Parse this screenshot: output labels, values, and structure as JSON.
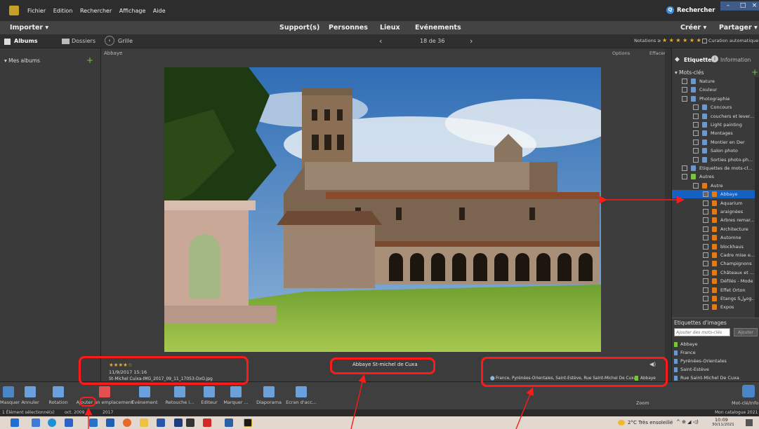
{
  "menubar": {
    "items": [
      "Fichier",
      "Edition",
      "Rechercher",
      "Affichage",
      "Aide"
    ],
    "search": "Rechercher"
  },
  "topbar": {
    "import": "Importer",
    "support": "Support(s)",
    "persons": "Personnes",
    "places": "Lieux",
    "events": "Evénements",
    "create": "Créer",
    "share": "Partager"
  },
  "subbar": {
    "albums": "Albums",
    "folders": "Dossiers",
    "grid": "Grille",
    "page": "18 de 36",
    "ratings": "Notations ≥",
    "auto_curation": "Curation automatique",
    "options": "Options",
    "clear": "Effacer"
  },
  "left": {
    "my_albums": "Mes albums"
  },
  "photo": {
    "album": "Abbaye",
    "rating": 4,
    "date": "11/9/2017 15:16",
    "filename": "St-Michel Cuixa-IMG_2017_09_11_17053-DxO.jpg",
    "caption": "Abbaye St-michel de Cuxa",
    "location": "France, Pyrénées-Orientales, Saint-Estève, Rue Saint-Michel De Cuxa",
    "tag": "Abbaye"
  },
  "right": {
    "tab_tags": "Etiquettes",
    "tab_info": "Information",
    "keywords_title": "Mots-clés",
    "keywords": [
      {
        "label": "Nature",
        "depth": 1
      },
      {
        "label": "Couleur",
        "depth": 1
      },
      {
        "label": "Photographie",
        "depth": 1
      },
      {
        "label": "Concours",
        "depth": 2
      },
      {
        "label": "couchers et lever...",
        "depth": 2
      },
      {
        "label": "Light painting",
        "depth": 2
      },
      {
        "label": "Montages",
        "depth": 2
      },
      {
        "label": "Montier en Der",
        "depth": 2
      },
      {
        "label": "Salon photo",
        "depth": 2
      },
      {
        "label": "Sorties photo-ph...",
        "depth": 2
      },
      {
        "label": "Etiquettes de mots-cl...",
        "depth": 1
      },
      {
        "label": "Autres",
        "depth": 1
      },
      {
        "label": "Autre",
        "depth": 2
      },
      {
        "label": "Abbaye",
        "depth": 3,
        "selected": true
      },
      {
        "label": "Aquarium",
        "depth": 3
      },
      {
        "label": "araignées",
        "depth": 3
      },
      {
        "label": "Arbres remar...",
        "depth": 3
      },
      {
        "label": "Architecture",
        "depth": 3
      },
      {
        "label": "Automne",
        "depth": 3
      },
      {
        "label": "blockhaus",
        "depth": 3
      },
      {
        "label": "Cadre mise e...",
        "depth": 3
      },
      {
        "label": "Champignons",
        "depth": 3
      },
      {
        "label": "Châteaux et ...",
        "depth": 3
      },
      {
        "label": "Défilés - Mode",
        "depth": 3
      },
      {
        "label": "Effet Orton",
        "depth": 3
      },
      {
        "label": "Etangs Sولog...",
        "depth": 3
      },
      {
        "label": "Expos",
        "depth": 3
      }
    ],
    "image_tags_title": "Etiquettes d'images",
    "image_tags_placeholder": "Ajouter des mots-clés",
    "add_button": "Ajouter",
    "image_tags": [
      "Abbaye",
      "France",
      "Pyrénées-Orientales",
      "Saint-Estève",
      "Rue Saint-Michel De Cuxa"
    ]
  },
  "toolbar": {
    "items": [
      "Masquer",
      "Annuler",
      "Rotation",
      "Ajouter un emplacement",
      "Evénement",
      "Retouche i...",
      "Editeur",
      "Marquer ...",
      "Diaporama",
      "Ecran d'acc..."
    ],
    "zoom": "Zoom",
    "keyword_info": "Mot-clé/Info"
  },
  "status": {
    "selected": "1 Élément sélectionné(s)",
    "date": "oct. 2009",
    "year": "2017",
    "catalog": "Mon catalogue 2021"
  },
  "taskbar": {
    "weather": "2°C Très ensoleillé",
    "time": "10:09",
    "date": "30/11/2021"
  },
  "colors": {
    "accent": "#1461c2",
    "annotation": "#ff1a1a",
    "tag_orange": "#e07b17",
    "tag_blue": "#6d98c9"
  }
}
